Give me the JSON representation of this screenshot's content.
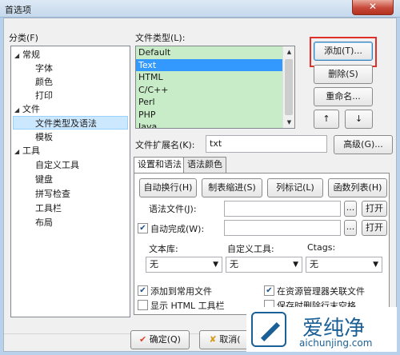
{
  "window": {
    "title": "首选项",
    "close_glyph": "✕"
  },
  "category": {
    "label": "分类(F)",
    "items": [
      {
        "label": "常规",
        "level": 0,
        "expanded": true
      },
      {
        "label": "字体",
        "level": 1
      },
      {
        "label": "颜色",
        "level": 1
      },
      {
        "label": "打印",
        "level": 1
      },
      {
        "label": "文件",
        "level": 0,
        "expanded": true
      },
      {
        "label": "文件类型及语法",
        "level": 1,
        "selected": true
      },
      {
        "label": "模板",
        "level": 1
      },
      {
        "label": "工具",
        "level": 0,
        "expanded": true
      },
      {
        "label": "自定义工具",
        "level": 1
      },
      {
        "label": "键盘",
        "level": 1
      },
      {
        "label": "拼写检查",
        "level": 1
      },
      {
        "label": "工具栏",
        "level": 1
      },
      {
        "label": "布局",
        "level": 1
      }
    ]
  },
  "filetypes": {
    "label": "文件类型(L):",
    "items": [
      "Default",
      "Text",
      "HTML",
      "C/C++",
      "Perl",
      "PHP",
      "Java"
    ],
    "selected": "Text",
    "add": "添加(T)...",
    "delete": "删除(S)",
    "rename": "重命名...",
    "up": "↑",
    "down": "↓"
  },
  "extension": {
    "label": "文件扩展名(K):",
    "value": "txt",
    "advanced": "高级(G)..."
  },
  "tabs": [
    "设置和语法",
    "语法颜色"
  ],
  "panel": {
    "btn_autowrap": "自动换行(H)",
    "btn_tabindent": "制表缩进(S)",
    "btn_columnmark": "列标记(L)",
    "btn_funclist": "函数列表(H)",
    "syntax_file_label": "语法文件(J):",
    "syntax_file_value": "",
    "autocomplete_label": "自动完成(W):",
    "autocomplete_checked": true,
    "autocomplete_value": "",
    "browse": "...",
    "open": "打开",
    "library_label": "文本库:",
    "custom_tool_label": "自定义工具:",
    "ctags_label": "Ctags:",
    "library_value": "无",
    "custom_tool_value": "无",
    "ctags_value": "无",
    "add_to_common": "添加到常用文件",
    "add_to_common_checked": true,
    "associate_explorer": "在资源管理器关联文件",
    "associate_explorer_checked": true,
    "show_html_toolbar": "显示 HTML 工具栏",
    "show_html_toolbar_checked": false,
    "remove_trailing_spaces": "保存时删除行末空格",
    "remove_trailing_spaces_checked": false
  },
  "footer": {
    "ok": "确定(Q)",
    "cancel": "取消("
  },
  "watermark": {
    "name": "爱纯净",
    "url": "aichunjing.com"
  },
  "colors": {
    "list_bg": "#c8ecc8",
    "selection": "#3399ff",
    "highlight_box": "#e0302a"
  }
}
